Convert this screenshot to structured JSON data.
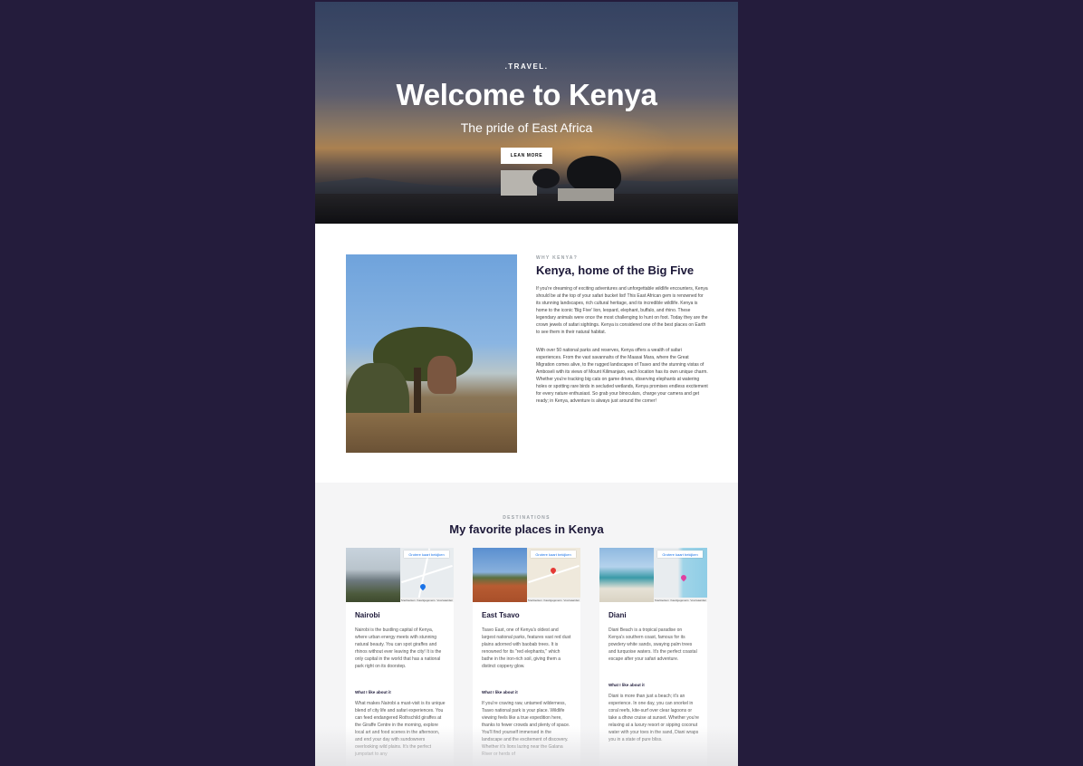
{
  "hero": {
    "kicker": ".TRAVEL.",
    "title": "Welcome to Kenya",
    "subtitle": "The pride of East Africa",
    "button_label": "LEAN MORE"
  },
  "about": {
    "kicker": "WHY KENYA?",
    "title": "Kenya, home of the Big Five",
    "paragraph1": "If you're dreaming of exciting adventures and unforgettable wildlife encounters, Kenya should be at the top of your safari bucket list! This East African gem is renowned for its stunning landscapes, rich cultural heritage, and its incredible wildlife. Kenya is home to the iconic 'Big Five' lion, leopard, elephant, buffalo, and rhino. These legendary animals were once the most challenging to hunt on foot. Today they are the crown jewels of safari sightings. Kenya is considered one of the best places on Earth to see them in their natural habitat.",
    "paragraph2": "With over 50 national parks and reserves, Kenya offers a wealth of safari experiences. From the vast savannahs of the Maasai Mara, where the Great Migration comes alive, to the rugged landscapes of Tsavo and the stunning vistas of Amboseli with its views of Mount Kilimanjaro, each location has its own unique charm. Whether you're tracking big cats on game drives, observing elephants at watering holes or spotting rare birds in secluded wetlands, Kenya promises endless excitement for every nature enthusiast. So grab your binoculars, charge your camera and get ready; in Kenya, adventure is always just around the corner!"
  },
  "destinations": {
    "kicker": "DESTINATIONS",
    "title": "My favorite places in Kenya",
    "map_button_label": "Grotere kaart bekijken",
    "map_footer_left": "Sneltoetsen",
    "map_footer_mid": "Kaartgegevens",
    "map_footer_right": "Voorwaarden",
    "like_label": "What I like about it",
    "cards": [
      {
        "name": "Nairobi",
        "description": "Nairobi is the bustling capital of Kenya, where urban energy meets with stunning natural beauty. You can spot giraffes and rhinos without ever leaving the city! It is the only capital in the world that has a national park right on its doorstep.",
        "like_text": "What makes Nairobi a must-visit is its unique blend of city life and safari experiences. You can feed endangered Rothschild giraffes at the Giraffe Centre in the morning, explore local art and food scenes in the afternoon, and end your day with sundowners overlooking wild plains. It's the perfect jumpstart to any"
      },
      {
        "name": "East Tsavo",
        "description": "Tsavo East, one of Kenya's oldest and largest national parks, features vast red dust plains adorned with baobab trees. It is renowned for its \"red elephants,\" which bathe in the iron-rich soil, giving them a distinct coppery glow.",
        "like_text": "If you're craving raw, untamed wilderness, Tsavo national park is your place. Wildlife viewing feels like a true expedition here, thanks to fewer crowds and plenty of space. You'll find yourself immersed in the landscape and the excitement of discovery. Whether it's lions lazing near the Galana River or herds of"
      },
      {
        "name": "Diani",
        "description": "Diani Beach is a tropical paradise on Kenya's southern coast, famous for its powdery white sands, swaying palm trees and turquoise waters. It's the perfect coastal escape after your safari adventure.",
        "like_text": "Diani is more than just a beach; it's an experience. In one day, you can snorkel in coral reefs, kite-surf over clear lagoons or take a dhow cruise at sunset. Whether you're relaxing at a luxury resort or sipping coconut water with your toes in the sand, Diani wraps you in a state of pure bliss."
      }
    ]
  }
}
